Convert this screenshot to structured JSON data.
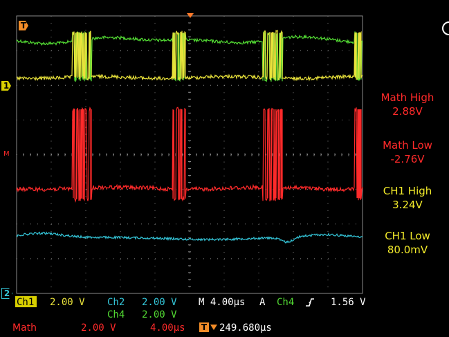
{
  "colors": {
    "ch1": "#e9e23b",
    "ch2": "#34c5d8",
    "ch4": "#52d933",
    "math": "#ff2a2a",
    "trigger": "#ff7a2a",
    "grid": "#8a8a8a"
  },
  "markers": {
    "trigger_top": "T",
    "ch1_ref": "1",
    "ch2_ref": "2",
    "math_ref": "M"
  },
  "measurements": [
    {
      "label": "Math High",
      "value": "2.88V",
      "color": "math"
    },
    {
      "label": "Math Low",
      "value": "-2.76V",
      "color": "math"
    },
    {
      "label": "CH1 High",
      "value": "3.24V",
      "color": "ch1"
    },
    {
      "label": "CH1 Low",
      "value": "80.0mV",
      "color": "ch1"
    }
  ],
  "status_bar": {
    "ch1_label": "Ch1",
    "ch1_scale": "2.00 V",
    "ch2_label": "Ch2",
    "ch2_scale": "2.00 V",
    "ch4_label": "Ch4",
    "ch4_scale": "2.00 V",
    "timebase": "M 4.00µs",
    "trigger_mode": "A",
    "trigger_source": "Ch4",
    "trigger_slope_icon": "rising-edge-icon",
    "trigger_level": "1.56 V",
    "math_label": "Math",
    "math_scale": "2.00 V",
    "math_time": "4.00µs",
    "trigger_position_icon": "trigger-position-icon",
    "trigger_position": "249.680µs"
  }
}
